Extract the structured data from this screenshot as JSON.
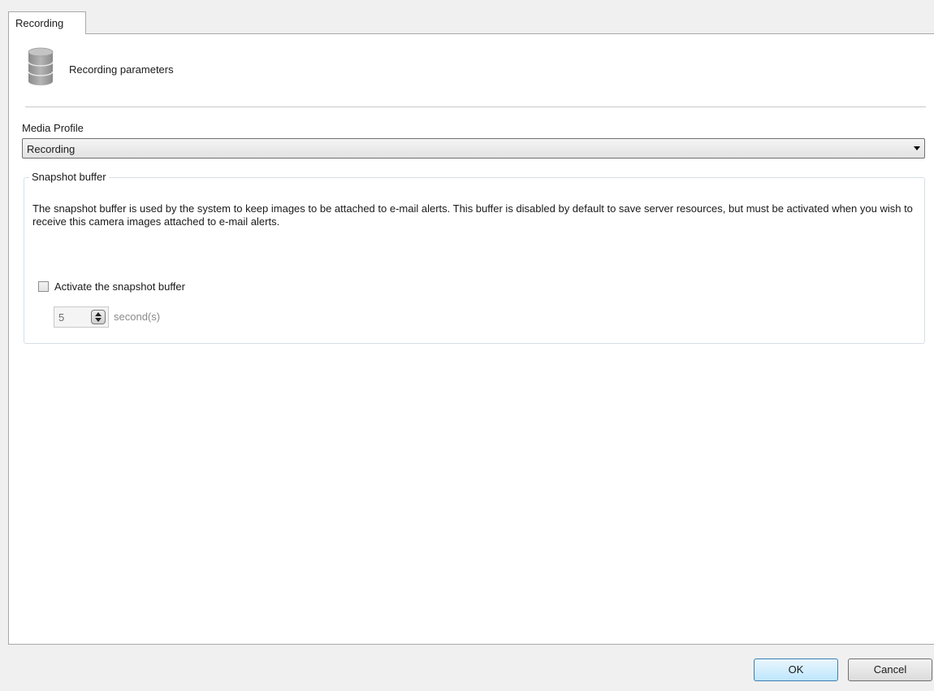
{
  "tabs": [
    {
      "label": "Recording",
      "selected": true
    }
  ],
  "header": {
    "icon": "database-icon",
    "title": "Recording parameters"
  },
  "media_profile": {
    "label": "Media Profile",
    "selected_value": "Recording"
  },
  "snapshot_buffer": {
    "group_title": "Snapshot buffer",
    "description": "The snapshot buffer is used by the system to keep images to be attached to e-mail alerts. This buffer is disabled by default to save server resources, but must be activated when you wish to receive this camera images attached to e-mail alerts.",
    "checkbox_label": "Activate the snapshot buffer",
    "checked": false,
    "duration_value": "5",
    "duration_unit": "second(s)"
  },
  "buttons": {
    "ok_label": "OK",
    "cancel_label": "Cancel"
  },
  "colors": {
    "ok_accent": "#3c7fb1",
    "background": "#f0f0f0",
    "panel": "#ffffff"
  }
}
